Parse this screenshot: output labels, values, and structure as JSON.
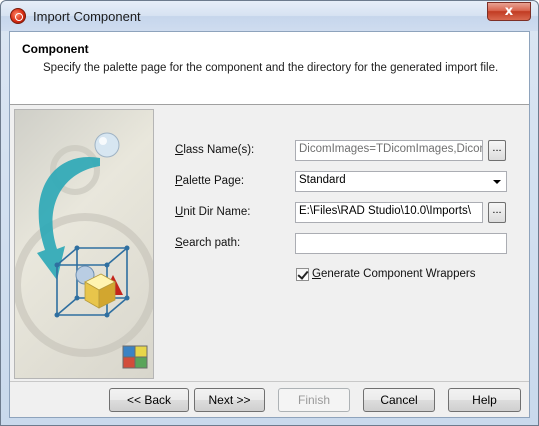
{
  "window": {
    "title": "Import Component",
    "close_glyph": "x"
  },
  "header": {
    "title": "Component",
    "description": "Specify the palette page for the component and the directory for the generated import file."
  },
  "form": {
    "class_names": {
      "label_hotkey": "C",
      "label_rest": "lass Name(s):",
      "value": "DicomImages=TDicomImages,DicomIm"
    },
    "palette_page": {
      "label_hotkey": "P",
      "label_rest": "alette Page:",
      "value": "Standard"
    },
    "unit_dir": {
      "label_hotkey": "U",
      "label_rest": "nit Dir Name:",
      "value": "E:\\Files\\RAD Studio\\10.0\\Imports\\"
    },
    "search_path": {
      "label_hotkey": "S",
      "label_rest": "earch path:",
      "value": ""
    },
    "browse_label": "...",
    "wrappers": {
      "label_hotkey": "G",
      "label_rest": "enerate Component Wrappers",
      "checked": true
    }
  },
  "buttons": {
    "back": "<< Back",
    "next": "Next >>",
    "finish": "Finish",
    "cancel": "Cancel",
    "help": "Help"
  },
  "colors": {
    "accent_arrow": "#2aa7b6",
    "title_bar": "#d6e2f2",
    "close_button": "#c13b22"
  }
}
